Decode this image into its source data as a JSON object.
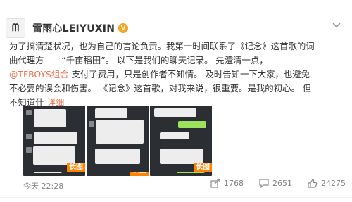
{
  "user": {
    "avatar_text": "ᗰ",
    "name": "雷雨心LEIYUXIN",
    "verified_badge": "V"
  },
  "post": {
    "line1": "为了搞清楚状况，也为自己的言论负责。我第一时间联系了《记念》这首歌的词",
    "line2": "曲代理方——“千亩稻田”。 以下是我们的聊天记录。 先澄清一点，",
    "mention": "@TFBOYS组合",
    "line3_rest": " 支付了费用，只是创作者不知情。 及时告知一下大家，也避免",
    "line4": "不必要的误会和伤害。 《记念》这首歌，对我来说，很重要。是我的初心。 但",
    "line5_start": "不知道什",
    "more_link": " 详细"
  },
  "images": [
    {
      "tag": ""
    },
    {
      "tag": "长图"
    },
    {
      "tag": ""
    },
    {
      "tag": "长图"
    }
  ],
  "footer": {
    "timestamp": "今天 22:28",
    "shares": "1768",
    "comments": "2651",
    "likes": "24275"
  },
  "icons": {
    "header_chevron": "chevron-down-icon",
    "share": "share-icon",
    "comment": "comment-icon",
    "like": "like-icon"
  },
  "colors": {
    "link": "#eb7350",
    "verified": "#f5a623",
    "long_image_tag": "#ff8200"
  }
}
